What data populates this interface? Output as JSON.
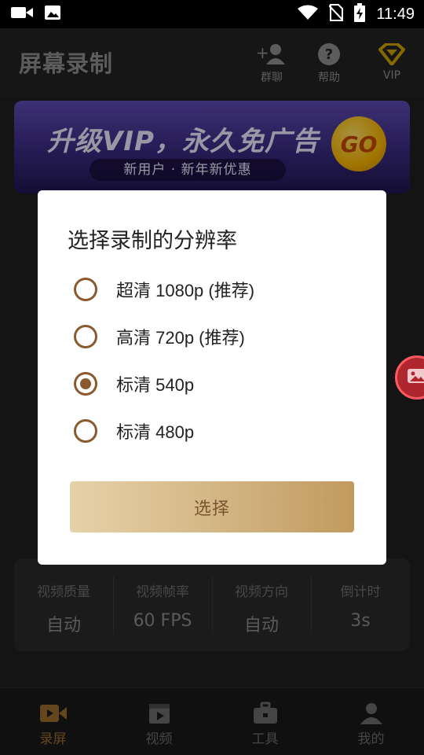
{
  "status_bar": {
    "time": "11:49",
    "icons": [
      "video-camera-icon",
      "image-icon",
      "wifi-icon",
      "no-sim-icon",
      "battery-charging-icon"
    ]
  },
  "app_bar": {
    "title": "屏幕录制",
    "actions": [
      {
        "label": "群聊",
        "icon": "group-chat-icon"
      },
      {
        "label": "帮助",
        "icon": "help-icon"
      },
      {
        "label": "VIP",
        "icon": "vip-diamond-icon"
      }
    ]
  },
  "banner": {
    "title": "升级VIP，永久免广告",
    "subtitle": "新用户 · 新年新优惠",
    "badge": "GO"
  },
  "dialog": {
    "title": "选择录制的分辨率",
    "options": [
      {
        "label": "超清 1080p (推荐)",
        "selected": false
      },
      {
        "label": "高清 720p (推荐)",
        "selected": false
      },
      {
        "label": "标清 540p",
        "selected": true
      },
      {
        "label": "标清 480p",
        "selected": false
      }
    ],
    "confirm_label": "选择"
  },
  "settings": [
    {
      "label": "视频质量",
      "value": "自动"
    },
    {
      "label": "视频帧率",
      "value": "60 FPS"
    },
    {
      "label": "视频方向",
      "value": "自动"
    },
    {
      "label": "倒计时",
      "value": "3s"
    }
  ],
  "bottom_nav": [
    {
      "label": "录屏",
      "icon": "record-camera-icon",
      "active": true
    },
    {
      "label": "视频",
      "icon": "video-clapper-icon",
      "active": false
    },
    {
      "label": "工具",
      "icon": "toolbox-icon",
      "active": false
    },
    {
      "label": "我的",
      "icon": "profile-icon",
      "active": false
    }
  ],
  "colors": {
    "accent": "#8a5a2e",
    "button_gradient_start": "#e6d2a8",
    "button_gradient_end": "#c19a5e",
    "float_button": "#b0262e"
  }
}
